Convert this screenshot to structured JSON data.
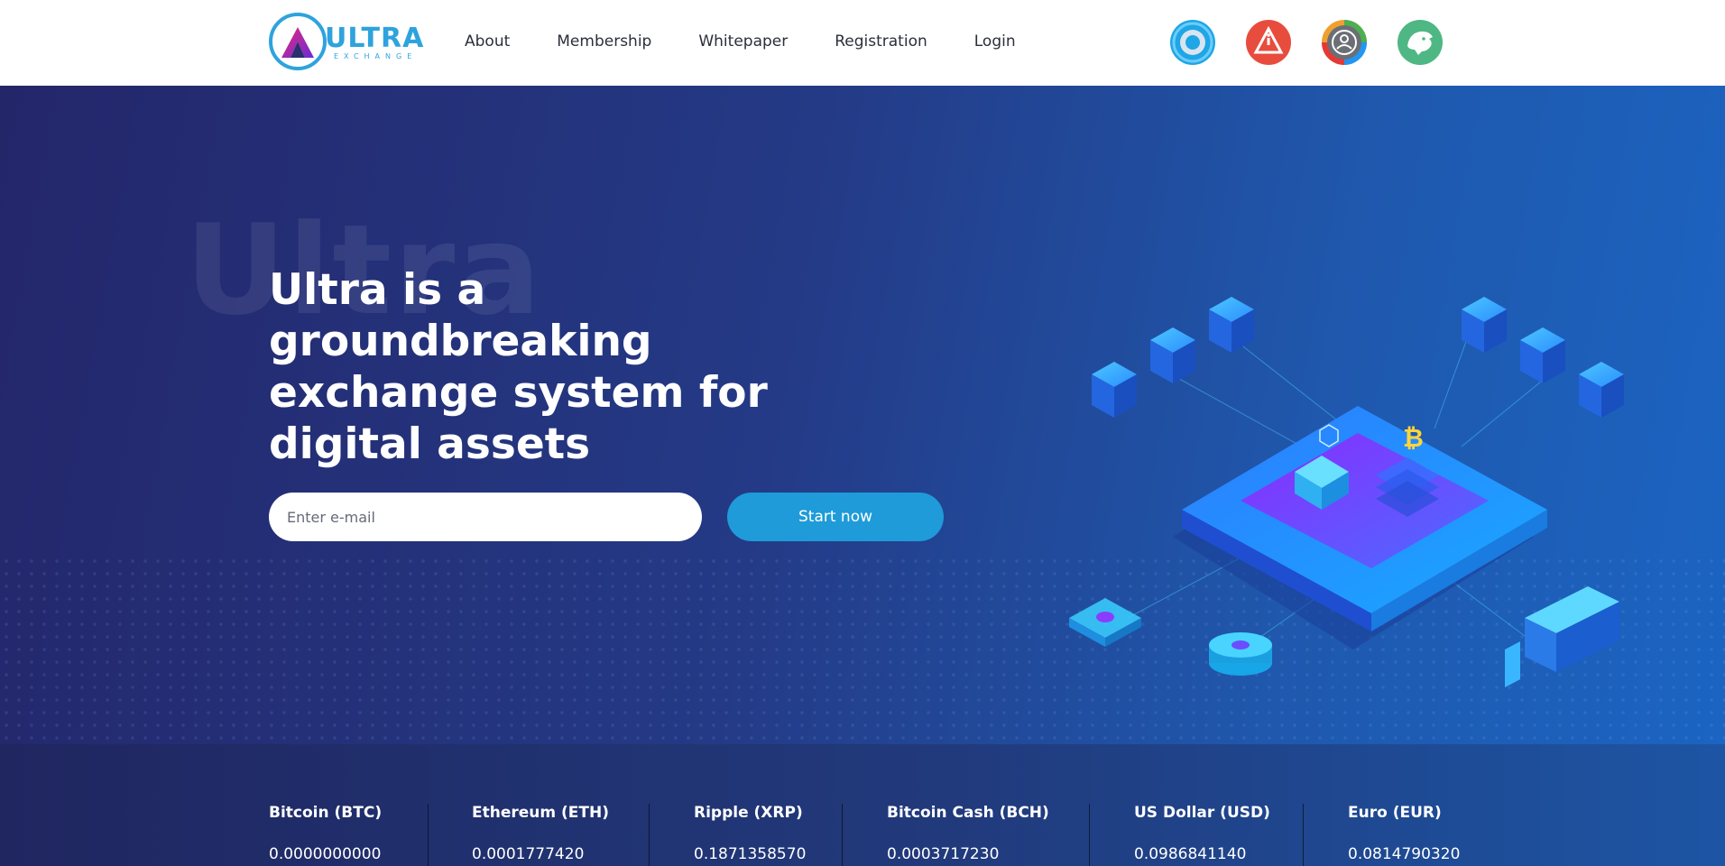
{
  "header": {
    "logo": {
      "word": "ULTRA",
      "sub": "EXCHANGE"
    },
    "nav": [
      {
        "label": "About"
      },
      {
        "label": "Membership"
      },
      {
        "label": "Whitepaper"
      },
      {
        "label": "Registration"
      },
      {
        "label": "Login"
      }
    ],
    "icons": [
      {
        "name": "ring-app-icon",
        "color": "#1ea6e6"
      },
      {
        "name": "alert-app-icon",
        "color": "#e84c3d"
      },
      {
        "name": "user-app-icon",
        "color": "#6b6e75"
      },
      {
        "name": "lion-app-icon",
        "color": "#4fb783"
      }
    ]
  },
  "hero": {
    "bg_word": "Ultra",
    "headline": "Ultra is a groundbreaking exchange system for digital assets",
    "email_placeholder": "Enter e-mail",
    "start_label": "Start now",
    "accent": "#1e9bd8",
    "bitcoin_glyph": "₿"
  },
  "ticker": [
    {
      "name": "Bitcoin (BTC)",
      "value": "0.0000000000"
    },
    {
      "name": "Ethereum (ETH)",
      "value": "0.0001777420"
    },
    {
      "name": "Ripple (XRP)",
      "value": "0.1871358570"
    },
    {
      "name": "Bitcoin Cash (BCH)",
      "value": "0.0003717230"
    },
    {
      "name": "US Dollar (USD)",
      "value": "0.0986841140"
    },
    {
      "name": "Euro (EUR)",
      "value": "0.0814790320"
    }
  ]
}
